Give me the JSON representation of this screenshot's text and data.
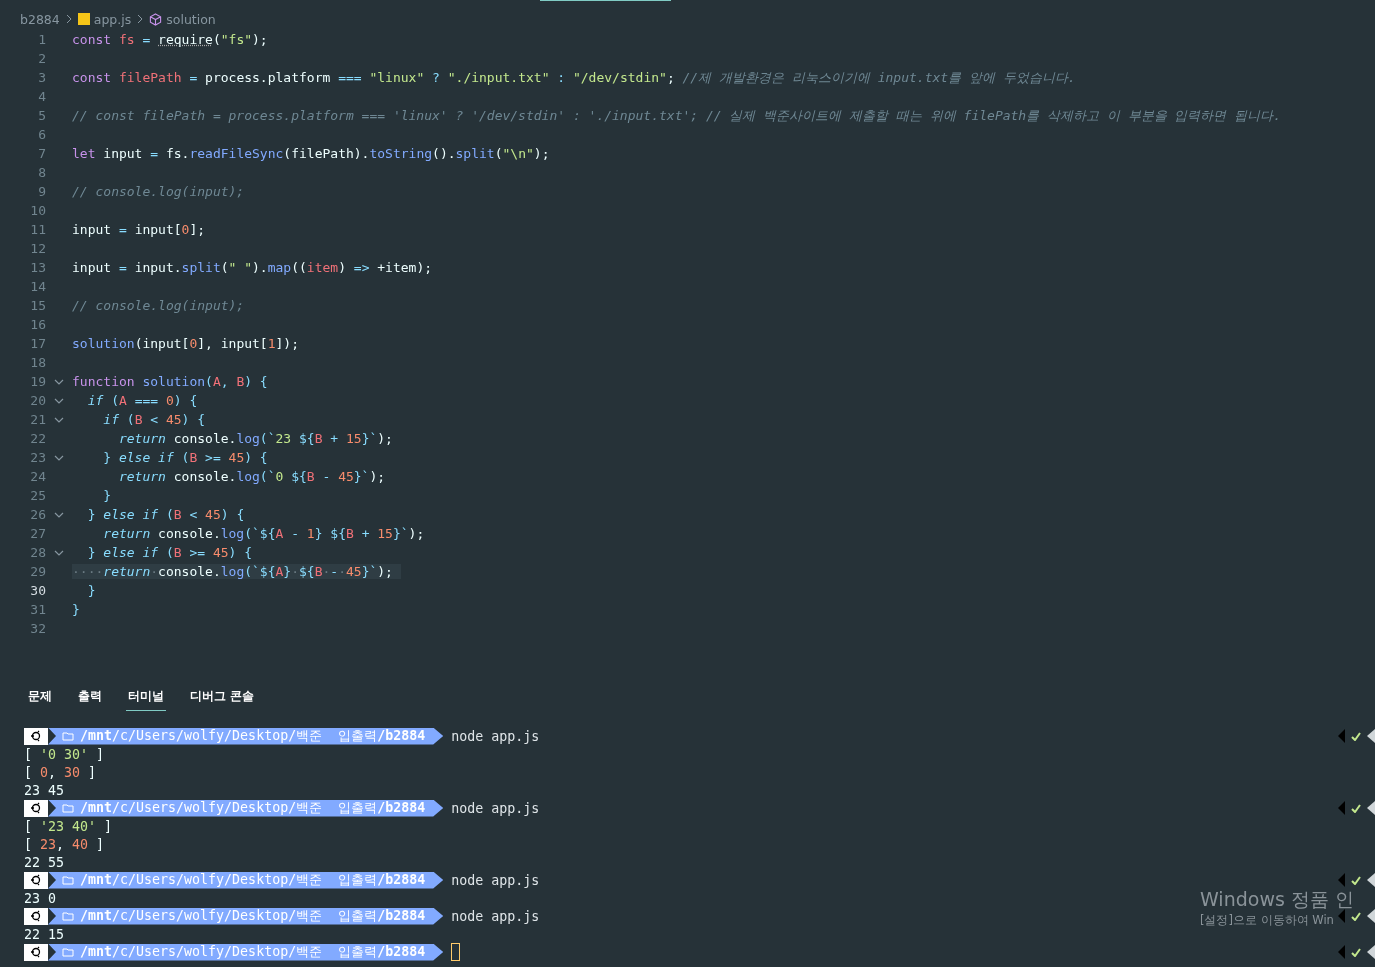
{
  "breadcrumbs": [
    {
      "label": "b2884",
      "kind": "folder"
    },
    {
      "label": "app.js",
      "kind": "js"
    },
    {
      "label": "solution",
      "kind": "symbol"
    }
  ],
  "editor": {
    "lines": [
      {
        "number": "1",
        "foldable": false,
        "active": false,
        "highlighted": false,
        "tokens": [
          {
            "kind": "kw",
            "text": "const "
          },
          {
            "kind": "var",
            "text": "fs "
          },
          {
            "kind": "op",
            "text": "= "
          },
          {
            "kind": "hint",
            "text": "require"
          },
          {
            "kind": "p",
            "text": "("
          },
          {
            "kind": "str",
            "text": "\"fs\""
          },
          {
            "kind": "p",
            "text": ");"
          }
        ]
      },
      {
        "number": "2",
        "foldable": false,
        "active": false,
        "highlighted": false
      },
      {
        "number": "3",
        "foldable": false,
        "active": false,
        "highlighted": false,
        "tokens": [
          {
            "kind": "kw",
            "text": "const "
          },
          {
            "kind": "var",
            "text": "filePath "
          },
          {
            "kind": "op",
            "text": "= "
          },
          {
            "kind": "p",
            "text": "process.platform "
          },
          {
            "kind": "op",
            "text": "=== "
          },
          {
            "kind": "str",
            "text": "\"linux\" "
          },
          {
            "kind": "op",
            "text": "? "
          },
          {
            "kind": "str",
            "text": "\"./input.txt\" "
          },
          {
            "kind": "op",
            "text": ": "
          },
          {
            "kind": "str",
            "text": "\"/dev/stdin\""
          },
          {
            "kind": "p",
            "text": "; "
          },
          {
            "kind": "cm",
            "text": "//제 개발환경은 리눅스이기에 input.txt를 앞에 두었습니다."
          }
        ]
      },
      {
        "number": "4",
        "foldable": false,
        "active": false,
        "highlighted": false
      },
      {
        "number": "5",
        "foldable": false,
        "active": false,
        "highlighted": false,
        "tokens": [
          {
            "kind": "cm",
            "text": "// const filePath = process.platform === 'linux' ? '/dev/stdin' : './input.txt'; // 실제 백준사이트에 제출할 때는 위에 filePath를 삭제하고 이 부분을 입력하면 됩니다."
          }
        ]
      },
      {
        "number": "6",
        "foldable": false,
        "active": false,
        "highlighted": false
      },
      {
        "number": "7",
        "foldable": false,
        "active": false,
        "highlighted": false,
        "tokens": [
          {
            "kind": "kw",
            "text": "let "
          },
          {
            "kind": "p",
            "text": "input "
          },
          {
            "kind": "op",
            "text": "= "
          },
          {
            "kind": "p",
            "text": "fs."
          },
          {
            "kind": "fn",
            "text": "readFileSync"
          },
          {
            "kind": "p",
            "text": "(filePath)."
          },
          {
            "kind": "fn",
            "text": "toString"
          },
          {
            "kind": "p",
            "text": "()."
          },
          {
            "kind": "fn",
            "text": "split"
          },
          {
            "kind": "p",
            "text": "("
          },
          {
            "kind": "str",
            "text": "\"\\n\""
          },
          {
            "kind": "p",
            "text": ");"
          }
        ]
      },
      {
        "number": "8",
        "foldable": false,
        "active": false,
        "highlighted": false
      },
      {
        "number": "9",
        "foldable": false,
        "active": false,
        "highlighted": false,
        "tokens": [
          {
            "kind": "cm",
            "text": "// console.log(input);"
          }
        ]
      },
      {
        "number": "10",
        "foldable": false,
        "active": false,
        "highlighted": false
      },
      {
        "number": "11",
        "foldable": false,
        "active": false,
        "highlighted": false,
        "tokens": [
          {
            "kind": "p",
            "text": "input "
          },
          {
            "kind": "op",
            "text": "= "
          },
          {
            "kind": "p",
            "text": "input["
          },
          {
            "kind": "num",
            "text": "0"
          },
          {
            "kind": "p",
            "text": "];"
          }
        ]
      },
      {
        "number": "12",
        "foldable": false,
        "active": false,
        "highlighted": false
      },
      {
        "number": "13",
        "foldable": false,
        "active": false,
        "highlighted": false,
        "tokens": [
          {
            "kind": "p",
            "text": "input "
          },
          {
            "kind": "op",
            "text": "= "
          },
          {
            "kind": "p",
            "text": "input."
          },
          {
            "kind": "fn",
            "text": "split"
          },
          {
            "kind": "p",
            "text": "("
          },
          {
            "kind": "str",
            "text": "\" \""
          },
          {
            "kind": "p",
            "text": ")."
          },
          {
            "kind": "fn",
            "text": "map"
          },
          {
            "kind": "p",
            "text": "(("
          },
          {
            "kind": "var",
            "text": "item"
          },
          {
            "kind": "p",
            "text": ") "
          },
          {
            "kind": "op",
            "text": "=> "
          },
          {
            "kind": "p",
            "text": "+item);"
          }
        ]
      },
      {
        "number": "14",
        "foldable": false,
        "active": false,
        "highlighted": false
      },
      {
        "number": "15",
        "foldable": false,
        "active": false,
        "highlighted": false,
        "tokens": [
          {
            "kind": "cm",
            "text": "// console.log(input);"
          }
        ]
      },
      {
        "number": "16",
        "foldable": false,
        "active": false,
        "highlighted": false
      },
      {
        "number": "17",
        "foldable": false,
        "active": false,
        "highlighted": false,
        "tokens": [
          {
            "kind": "fn",
            "text": "solution"
          },
          {
            "kind": "p",
            "text": "(input["
          },
          {
            "kind": "num",
            "text": "0"
          },
          {
            "kind": "p",
            "text": "], input["
          },
          {
            "kind": "num",
            "text": "1"
          },
          {
            "kind": "p",
            "text": "]);"
          }
        ]
      },
      {
        "number": "18",
        "foldable": false,
        "active": false,
        "highlighted": false
      },
      {
        "number": "19",
        "foldable": true,
        "active": false,
        "highlighted": false,
        "tokens": [
          {
            "kind": "kw",
            "text": "function "
          },
          {
            "kind": "fn",
            "text": "solution"
          },
          {
            "kind": "op",
            "text": "("
          },
          {
            "kind": "var",
            "text": "A"
          },
          {
            "kind": "op",
            "text": ", "
          },
          {
            "kind": "var",
            "text": "B"
          },
          {
            "kind": "op",
            "text": ") {"
          }
        ]
      },
      {
        "number": "20",
        "foldable": true,
        "active": false,
        "highlighted": false,
        "tokens": [
          {
            "kind": "ctrl",
            "text": "  if "
          },
          {
            "kind": "op",
            "text": "("
          },
          {
            "kind": "var",
            "text": "A "
          },
          {
            "kind": "op",
            "text": "=== "
          },
          {
            "kind": "num",
            "text": "0"
          },
          {
            "kind": "op",
            "text": ") {"
          }
        ]
      },
      {
        "number": "21",
        "foldable": true,
        "active": false,
        "highlighted": false,
        "tokens": [
          {
            "kind": "ctrl",
            "text": "    if "
          },
          {
            "kind": "op",
            "text": "("
          },
          {
            "kind": "var",
            "text": "B "
          },
          {
            "kind": "op",
            "text": "< "
          },
          {
            "kind": "num",
            "text": "45"
          },
          {
            "kind": "op",
            "text": ") {"
          }
        ]
      },
      {
        "number": "22",
        "foldable": false,
        "active": false,
        "highlighted": false,
        "tokens": [
          {
            "kind": "ctrl",
            "text": "      return "
          },
          {
            "kind": "p",
            "text": "console."
          },
          {
            "kind": "fn",
            "text": "log"
          },
          {
            "kind": "op",
            "text": "(`"
          },
          {
            "kind": "str",
            "text": "23 "
          },
          {
            "kind": "op",
            "text": "${"
          },
          {
            "kind": "var",
            "text": "B "
          },
          {
            "kind": "op",
            "text": "+ "
          },
          {
            "kind": "num",
            "text": "15"
          },
          {
            "kind": "op",
            "text": "}`"
          },
          {
            "kind": "p",
            "text": ");"
          }
        ]
      },
      {
        "number": "23",
        "foldable": true,
        "active": false,
        "highlighted": false,
        "tokens": [
          {
            "kind": "op",
            "text": "    } "
          },
          {
            "kind": "ctrl",
            "text": "else if "
          },
          {
            "kind": "op",
            "text": "("
          },
          {
            "kind": "var",
            "text": "B "
          },
          {
            "kind": "op",
            "text": ">= "
          },
          {
            "kind": "num",
            "text": "45"
          },
          {
            "kind": "op",
            "text": ") {"
          }
        ]
      },
      {
        "number": "24",
        "foldable": false,
        "active": false,
        "highlighted": false,
        "tokens": [
          {
            "kind": "ctrl",
            "text": "      return "
          },
          {
            "kind": "p",
            "text": "console."
          },
          {
            "kind": "fn",
            "text": "log"
          },
          {
            "kind": "op",
            "text": "(`"
          },
          {
            "kind": "str",
            "text": "0 "
          },
          {
            "kind": "op",
            "text": "${"
          },
          {
            "kind": "var",
            "text": "B "
          },
          {
            "kind": "op",
            "text": "- "
          },
          {
            "kind": "num",
            "text": "45"
          },
          {
            "kind": "op",
            "text": "}`"
          },
          {
            "kind": "p",
            "text": ");"
          }
        ]
      },
      {
        "number": "25",
        "foldable": false,
        "active": false,
        "highlighted": false,
        "tokens": [
          {
            "kind": "op",
            "text": "    }"
          }
        ]
      },
      {
        "number": "26",
        "foldable": true,
        "active": false,
        "highlighted": false,
        "tokens": [
          {
            "kind": "op",
            "text": "  } "
          },
          {
            "kind": "ctrl",
            "text": "else if "
          },
          {
            "kind": "op",
            "text": "("
          },
          {
            "kind": "var",
            "text": "B "
          },
          {
            "kind": "op",
            "text": "< "
          },
          {
            "kind": "num",
            "text": "45"
          },
          {
            "kind": "op",
            "text": ") {"
          }
        ]
      },
      {
        "number": "27",
        "foldable": false,
        "active": false,
        "highlighted": false,
        "tokens": [
          {
            "kind": "ctrl",
            "text": "    return "
          },
          {
            "kind": "p",
            "text": "console."
          },
          {
            "kind": "fn",
            "text": "log"
          },
          {
            "kind": "op",
            "text": "(`${"
          },
          {
            "kind": "var",
            "text": "A "
          },
          {
            "kind": "op",
            "text": "- "
          },
          {
            "kind": "num",
            "text": "1"
          },
          {
            "kind": "op",
            "text": "} ${"
          },
          {
            "kind": "var",
            "text": "B "
          },
          {
            "kind": "op",
            "text": "+ "
          },
          {
            "kind": "num",
            "text": "15"
          },
          {
            "kind": "op",
            "text": "}`"
          },
          {
            "kind": "p",
            "text": ");"
          }
        ]
      },
      {
        "number": "28",
        "foldable": true,
        "active": false,
        "highlighted": false,
        "tokens": [
          {
            "kind": "op",
            "text": "  } "
          },
          {
            "kind": "ctrl",
            "text": "else if "
          },
          {
            "kind": "op",
            "text": "("
          },
          {
            "kind": "var",
            "text": "B "
          },
          {
            "kind": "op",
            "text": ">= "
          },
          {
            "kind": "num",
            "text": "45"
          },
          {
            "kind": "op",
            "text": ") {"
          }
        ]
      },
      {
        "number": "29",
        "foldable": false,
        "active": false,
        "highlighted": true,
        "tokens": [
          {
            "kind": "ws",
            "text": "····"
          },
          {
            "kind": "ctrl",
            "text": "return"
          },
          {
            "kind": "ws",
            "text": "·"
          },
          {
            "kind": "p",
            "text": "console."
          },
          {
            "kind": "fn",
            "text": "log"
          },
          {
            "kind": "op",
            "text": "(`${"
          },
          {
            "kind": "var",
            "text": "A"
          },
          {
            "kind": "op",
            "text": "}"
          },
          {
            "kind": "ws",
            "text": "·"
          },
          {
            "kind": "op",
            "text": "${"
          },
          {
            "kind": "var",
            "text": "B"
          },
          {
            "kind": "ws",
            "text": "·"
          },
          {
            "kind": "op",
            "text": "-"
          },
          {
            "kind": "ws",
            "text": "·"
          },
          {
            "kind": "num",
            "text": "45"
          },
          {
            "kind": "op",
            "text": "}`"
          },
          {
            "kind": "p",
            "text": ");"
          }
        ]
      },
      {
        "number": "30",
        "foldable": false,
        "active": true,
        "highlighted": false,
        "tokens": [
          {
            "kind": "op",
            "text": "  }"
          }
        ]
      },
      {
        "number": "31",
        "foldable": false,
        "active": false,
        "highlighted": false,
        "tokens": [
          {
            "kind": "op",
            "text": "}"
          }
        ]
      },
      {
        "number": "32",
        "foldable": false,
        "active": false,
        "highlighted": false
      }
    ]
  },
  "panel": {
    "tabs": [
      {
        "label": "문제",
        "selected": false
      },
      {
        "label": "출력",
        "selected": false
      },
      {
        "label": "터미널",
        "selected": true
      },
      {
        "label": "디버그 콘솔",
        "selected": false
      }
    ],
    "terminal": [
      {
        "kind": "prompt",
        "path": [
          {
            "kind": "b",
            "text": "/mnt"
          },
          {
            "kind": "n",
            "text": "/c/Users/wolfy/Desktop/백준  입출력"
          },
          {
            "kind": "b",
            "text": "/b2884"
          }
        ],
        "command": "node app.js",
        "cursor": false
      },
      {
        "kind": "output",
        "tokens": [
          {
            "kind": "p",
            "text": "[ "
          },
          {
            "kind": "str",
            "text": "'0 30'"
          },
          {
            "kind": "p",
            "text": " ]"
          }
        ]
      },
      {
        "kind": "output",
        "tokens": [
          {
            "kind": "p",
            "text": "[ "
          },
          {
            "kind": "num",
            "text": "0"
          },
          {
            "kind": "p",
            "text": ", "
          },
          {
            "kind": "num",
            "text": "30"
          },
          {
            "kind": "p",
            "text": " ]"
          }
        ]
      },
      {
        "kind": "output",
        "tokens": [
          {
            "kind": "p",
            "text": "23 45"
          }
        ]
      },
      {
        "kind": "prompt",
        "path": [
          {
            "kind": "b",
            "text": "/mnt"
          },
          {
            "kind": "n",
            "text": "/c/Users/wolfy/Desktop/백준  입출력"
          },
          {
            "kind": "b",
            "text": "/b2884"
          }
        ],
        "command": "node app.js",
        "cursor": false
      },
      {
        "kind": "output",
        "tokens": [
          {
            "kind": "p",
            "text": "[ "
          },
          {
            "kind": "str",
            "text": "'23 40'"
          },
          {
            "kind": "p",
            "text": " ]"
          }
        ]
      },
      {
        "kind": "output",
        "tokens": [
          {
            "kind": "p",
            "text": "[ "
          },
          {
            "kind": "num",
            "text": "23"
          },
          {
            "kind": "p",
            "text": ", "
          },
          {
            "kind": "num",
            "text": "40"
          },
          {
            "kind": "p",
            "text": " ]"
          }
        ]
      },
      {
        "kind": "output",
        "tokens": [
          {
            "kind": "p",
            "text": "22 55"
          }
        ]
      },
      {
        "kind": "prompt",
        "path": [
          {
            "kind": "b",
            "text": "/mnt"
          },
          {
            "kind": "n",
            "text": "/c/Users/wolfy/Desktop/백준  입출력"
          },
          {
            "kind": "b",
            "text": "/b2884"
          }
        ],
        "command": "node app.js",
        "cursor": false
      },
      {
        "kind": "output",
        "tokens": [
          {
            "kind": "p",
            "text": "23 0"
          }
        ]
      },
      {
        "kind": "prompt",
        "path": [
          {
            "kind": "b",
            "text": "/mnt"
          },
          {
            "kind": "n",
            "text": "/c/Users/wolfy/Desktop/백준  입출력"
          },
          {
            "kind": "b",
            "text": "/b2884"
          }
        ],
        "command": "node app.js",
        "cursor": false
      },
      {
        "kind": "output",
        "tokens": [
          {
            "kind": "p",
            "text": "22 15"
          }
        ]
      },
      {
        "kind": "prompt",
        "path": [
          {
            "kind": "b",
            "text": "/mnt"
          },
          {
            "kind": "n",
            "text": "/c/Users/wolfy/Desktop/백준  입출력"
          },
          {
            "kind": "b",
            "text": "/b2884"
          }
        ],
        "cursor": true
      }
    ]
  },
  "activation_notice": {
    "title": "Windows 정품 인",
    "subtitle": "[설정]으로 이동하여 Win"
  }
}
